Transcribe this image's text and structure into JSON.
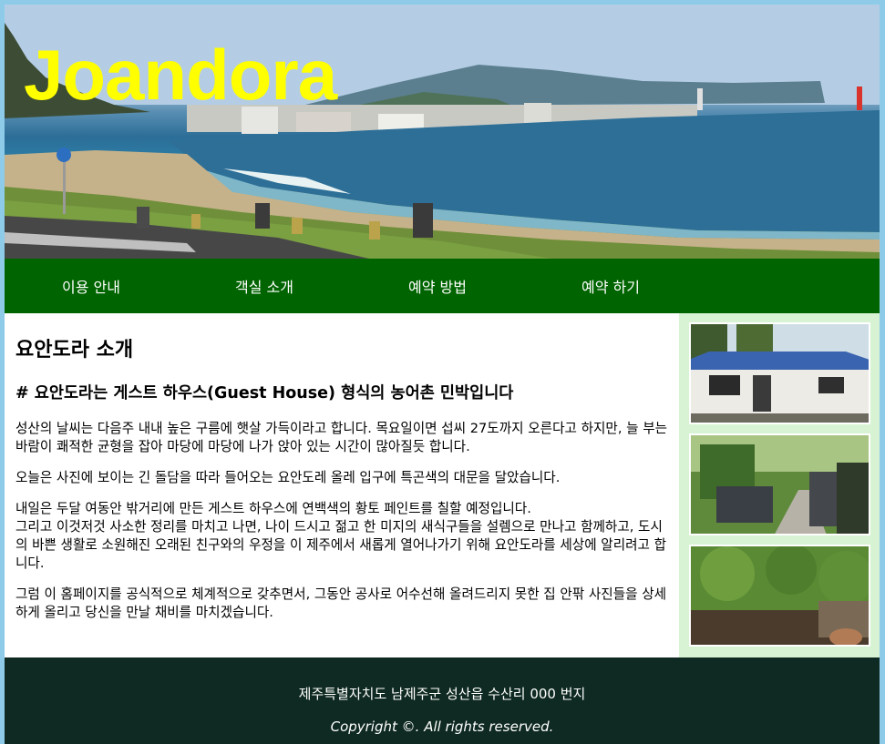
{
  "header": {
    "logo_text": "Joandora"
  },
  "nav": {
    "items": [
      {
        "label": "이용 안내"
      },
      {
        "label": "객실 소개"
      },
      {
        "label": "예약 방법"
      },
      {
        "label": "예약 하기"
      }
    ]
  },
  "main": {
    "title": "요안도라 소개",
    "subtitle": "# 요안도라는 게스트 하우스(Guest House) 형식의 농어촌 민박입니다",
    "paragraphs": [
      "성산의 날씨는 다음주 내내 높은 구름에 햇살 가득이라고 합니다. 목요일이면 섭씨 27도까지 오른다고 하지만, 늘 부는 바람이 쾌적한 균형을 잡아 마당에 마당에 나가 앉아 있는 시간이 많아질듯 합니다.",
      "오늘은 사진에 보이는 긴 돌담을 따라 들어오는 요안도레 올레 입구에 특곤색의 대문을 달았습니다.",
      "내일은 두달 여동안 밖거리에 만든 게스트 하우스에 연백색의 황토 페인트를 칠할 예정입니다.\n그리고 이것저것 사소한 정리를 마치고 나면, 나이 드시고 젊고 한 미지의 새식구들을 설렘으로 만나고 함께하고, 도시의 바쁜 생활로 소원해진 오래된 친구와의 우정을 이 제주에서 새롭게 열어나가기 위해 요안도라를 세상에 알리려고 합니다.",
      "그럼 이 홈페이지를 공식적으로 체계적으로 갖추면서, 그동안 공사로 어수선해 올려드리지 못한 집 안팎 사진들을 상세하게 올리고 당신을 만날 채비를 마치겠습니다."
    ]
  },
  "sidebar": {
    "photos": [
      {
        "icon": "house-photo"
      },
      {
        "icon": "stone-wall-alley-photo"
      },
      {
        "icon": "garden-photo"
      }
    ]
  },
  "footer": {
    "address": "제주특별자치도 남제주군 성산읍 수산리 000 번지",
    "copyright": "Copyright ©. All rights reserved."
  },
  "colors": {
    "page_bg": "#8ecbe8",
    "nav_bg": "#006400",
    "logo": "#ffff00",
    "sidebar_bg": "#d8f3d3",
    "footer_bg": "#0f2a22"
  }
}
